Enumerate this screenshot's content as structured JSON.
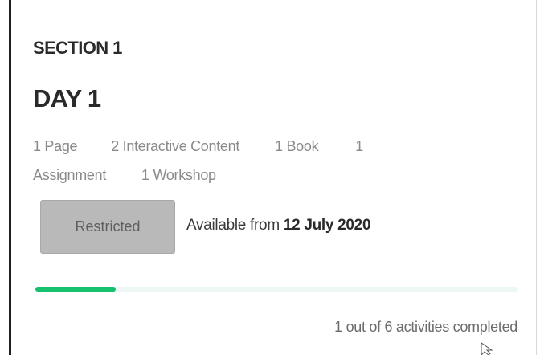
{
  "section": {
    "label": "SECTION 1"
  },
  "day": {
    "title": "DAY 1"
  },
  "activities": {
    "page": "1 Page",
    "interactive": "2 Interactive Content",
    "book": "1 Book",
    "assignment_count": "1",
    "assignment_label": "Assignment",
    "workshop": "1 Workshop"
  },
  "restriction": {
    "button_label": "Restricted",
    "available_prefix": "Available from",
    "available_date": "12 July 2020"
  },
  "progress": {
    "completed": 1,
    "total": 6,
    "fraction": 0.167,
    "text": "1 out of 6 activities completed",
    "fill_color": "#16c16d",
    "track_color": "#ecf7f6"
  },
  "icons": {
    "cursor": "pointer-cursor-icon"
  }
}
